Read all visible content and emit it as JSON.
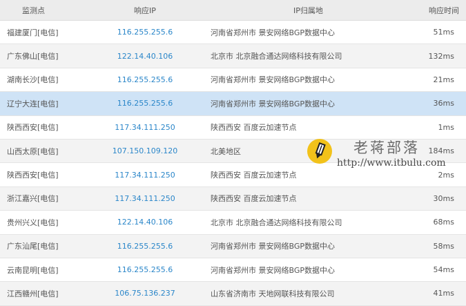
{
  "columns": {
    "point": "监测点",
    "ip": "响应IP",
    "location": "IP归属地",
    "time": "响应时间"
  },
  "rows": [
    {
      "point": "福建厦门[电信]",
      "ip": "116.255.255.6",
      "location": "河南省郑州市 景安网络BGP数据中心",
      "time": "51ms"
    },
    {
      "point": "广东佛山[电信]",
      "ip": "122.14.40.106",
      "location": "北京市 北京融合通达网络科技有限公司",
      "time": "132ms"
    },
    {
      "point": "湖南长沙[电信]",
      "ip": "116.255.255.6",
      "location": "河南省郑州市 景安网络BGP数据中心",
      "time": "21ms"
    },
    {
      "point": "辽宁大连[电信]",
      "ip": "116.255.255.6",
      "location": "河南省郑州市 景安网络BGP数据中心",
      "time": "36ms"
    },
    {
      "point": "陕西西安[电信]",
      "ip": "117.34.111.250",
      "location": "陕西西安 百度云加速节点",
      "time": "1ms"
    },
    {
      "point": "山西太原[电信]",
      "ip": "107.150.109.120",
      "location": "北美地区",
      "time": "184ms"
    },
    {
      "point": "陕西西安[电信]",
      "ip": "117.34.111.250",
      "location": "陕西西安 百度云加速节点",
      "time": "2ms"
    },
    {
      "point": "浙江嘉兴[电信]",
      "ip": "117.34.111.250",
      "location": "陕西西安 百度云加速节点",
      "time": "30ms"
    },
    {
      "point": "贵州兴义[电信]",
      "ip": "122.14.40.106",
      "location": "北京市 北京融合通达网络科技有限公司",
      "time": "68ms"
    },
    {
      "point": "广东汕尾[电信]",
      "ip": "116.255.255.6",
      "location": "河南省郑州市 景安网络BGP数据中心",
      "time": "58ms"
    },
    {
      "point": "云南昆明[电信]",
      "ip": "116.255.255.6",
      "location": "河南省郑州市 景安网络BGP数据中心",
      "time": "54ms"
    },
    {
      "point": "江西赣州[电信]",
      "ip": "106.75.136.237",
      "location": "山东省济南市 天地网联科技有限公司",
      "time": "41ms"
    }
  ],
  "highlighted_row": 4,
  "watermark": {
    "title": "老蒋部落",
    "url": "http://www.itbulu.com",
    "icon": "pencil-icon"
  },
  "colors": {
    "ip_link": "#2a86c9",
    "header_bg": "#ececec",
    "alt_row_bg": "#f3f3f3",
    "highlight_bg": "#cfe3f6",
    "logo_bg": "#f2c21a"
  }
}
